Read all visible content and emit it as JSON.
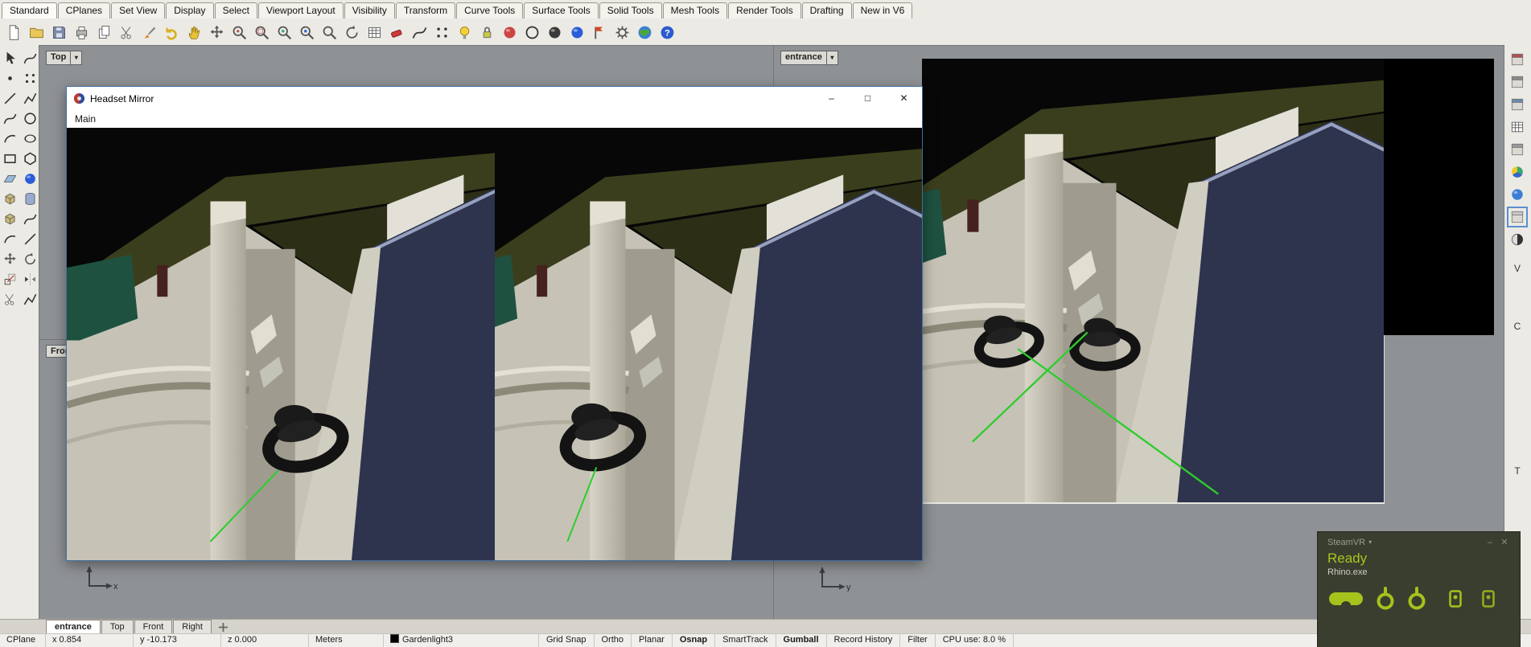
{
  "menu_bar": {
    "items": [
      "Standard",
      "CPlanes",
      "Set View",
      "Display",
      "Select",
      "Viewport Layout",
      "Visibility",
      "Transform",
      "Curve Tools",
      "Surface Tools",
      "Solid Tools",
      "Mesh Tools",
      "Render Tools",
      "Drafting",
      "New in V6"
    ]
  },
  "top_toolbar": {
    "icons": [
      "new-file",
      "open-file",
      "save-file",
      "print",
      "copy",
      "cut-scissors",
      "paint-brush",
      "undo-arrow",
      "pan-hand",
      "move-cross",
      "zoom-dynamic",
      "zoom-window",
      "zoom-extents",
      "zoom-selected",
      "zoom-target",
      "rotate-view",
      "named-views-table",
      "delete-eraser",
      "curve-tool",
      "point-tool",
      "light-bulb",
      "lock-toggle",
      "render-preview-sphere",
      "wireframe-sphere",
      "shaded-sphere",
      "rendered-sphere",
      "checkpoint-flag",
      "options-gear",
      "earth-globe",
      "help-circle"
    ]
  },
  "left_toolbar": {
    "icons": [
      "select-arrow",
      "lasso-select",
      "single-point",
      "point-grid",
      "line-tool",
      "polyline-tool",
      "curve-tool",
      "circle-tool",
      "arc-tool",
      "ellipse-tool",
      "rectangle-tool",
      "polygon-tool",
      "surface-plane",
      "sphere-tool",
      "box-tool",
      "cylinder-tool",
      "extrude-tool",
      "loft-tool",
      "fillet-tool",
      "chamfer-tool",
      "move-tool",
      "rotate-tool",
      "scale-tool",
      "mirror-tool",
      "trim-scissors",
      "join-tool"
    ]
  },
  "right_panel": {
    "icons": [
      "properties-panel",
      "layers-panel",
      "display-panel",
      "object-snap-panel",
      "notes-panel",
      "color-wheel",
      "material-sphere",
      "selected-panel",
      "render-settings-panel"
    ],
    "tab_letters": [
      "V",
      "C",
      "T"
    ]
  },
  "viewports": {
    "top_label": "Top",
    "front_label": "Front",
    "entrance_label": "entrance",
    "dropdown_glyph": "▾",
    "front_axis": "x",
    "entrance_axis": "y"
  },
  "headset_mirror": {
    "title": "Headset Mirror",
    "menu": "Main",
    "minimize": "–",
    "maximize": "□",
    "close": "✕"
  },
  "steamvr": {
    "title": "SteamVR",
    "caret": "▾",
    "minimize": "–",
    "close": "✕",
    "status": "Ready",
    "app_name": "Rhino.exe",
    "accent_color": "#a6c21d",
    "devices": [
      "vr-headset",
      "vr-controller-left",
      "vr-controller-right",
      "base-station-left",
      "base-station-right"
    ]
  },
  "viewport_tabs": {
    "active": "entrance",
    "tabs": [
      "entrance",
      "Top",
      "Front",
      "Right"
    ]
  },
  "status_bar": {
    "cplane": "CPlane",
    "x": "x 0.854",
    "y": "y -10.173",
    "z": "z 0.000",
    "units": "Meters",
    "layer": "Gardenlight3",
    "toggles": [
      {
        "label": "Grid Snap",
        "on": false
      },
      {
        "label": "Ortho",
        "on": false
      },
      {
        "label": "Planar",
        "on": false
      },
      {
        "label": "Osnap",
        "on": true
      },
      {
        "label": "SmartTrack",
        "on": false
      },
      {
        "label": "Gumball",
        "on": true
      },
      {
        "label": "Record History",
        "on": false
      },
      {
        "label": "Filter",
        "on": false
      }
    ],
    "cpu": "CPU use: 8.0 %"
  }
}
